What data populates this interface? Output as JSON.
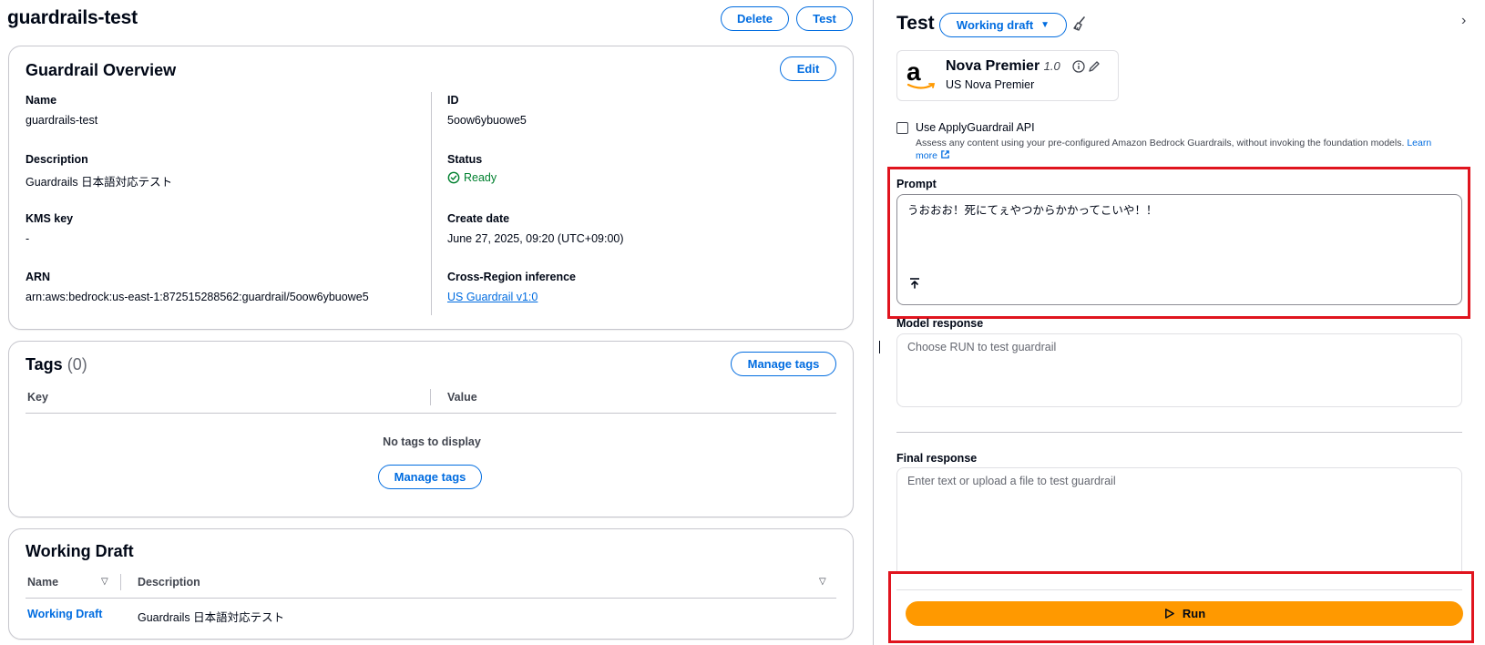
{
  "header": {
    "title": "guardrails-test",
    "delete_label": "Delete",
    "test_label": "Test"
  },
  "overview": {
    "title": "Guardrail Overview",
    "edit_label": "Edit",
    "name_label": "Name",
    "name_value": "guardrails-test",
    "description_label": "Description",
    "description_value": "Guardrails 日本語対応テスト",
    "kms_label": "KMS key",
    "kms_value": "-",
    "arn_label": "ARN",
    "arn_value": "arn:aws:bedrock:us-east-1:872515288562:guardrail/5oow6ybuowe5",
    "id_label": "ID",
    "id_value": "5oow6ybuowe5",
    "status_label": "Status",
    "status_value": "Ready",
    "create_date_label": "Create date",
    "create_date_value": "June 27, 2025, 09:20 (UTC+09:00)",
    "cross_region_label": "Cross-Region inference",
    "cross_region_value": "US Guardrail v1:0"
  },
  "tags": {
    "title": "Tags",
    "count": "(0)",
    "manage_label": "Manage tags",
    "col_key": "Key",
    "col_value": "Value",
    "empty_text": "No tags to display",
    "empty_manage_label": "Manage tags"
  },
  "working_draft": {
    "title": "Working Draft",
    "col_name": "Name",
    "col_description": "Description",
    "rows": [
      {
        "name": "Working Draft",
        "description": "Guardrails 日本語対応テスト"
      }
    ]
  },
  "test_panel": {
    "title": "Test",
    "version_dropdown": "Working draft",
    "model_name": "Nova Premier",
    "model_version": "1.0",
    "model_sub": "US Nova Premier",
    "apply_api_label": "Use ApplyGuardrail API",
    "apply_api_desc": "Assess any content using your pre-configured Amazon Bedrock Guardrails, without invoking the foundation models.",
    "learn_more_1": "Learn",
    "learn_more_2": "more",
    "prompt_label": "Prompt",
    "prompt_value": "うおおお！死にてぇやつからかかってこいや！！",
    "model_response_label": "Model response",
    "model_response_placeholder": "Choose RUN to test guardrail",
    "final_response_label": "Final response",
    "final_response_placeholder": "Enter text or upload a file to test guardrail",
    "run_label": "Run"
  },
  "colors": {
    "accent": "#006ce0",
    "run": "#ff9900",
    "ready": "#00802f",
    "highlight": "#e0141e"
  }
}
